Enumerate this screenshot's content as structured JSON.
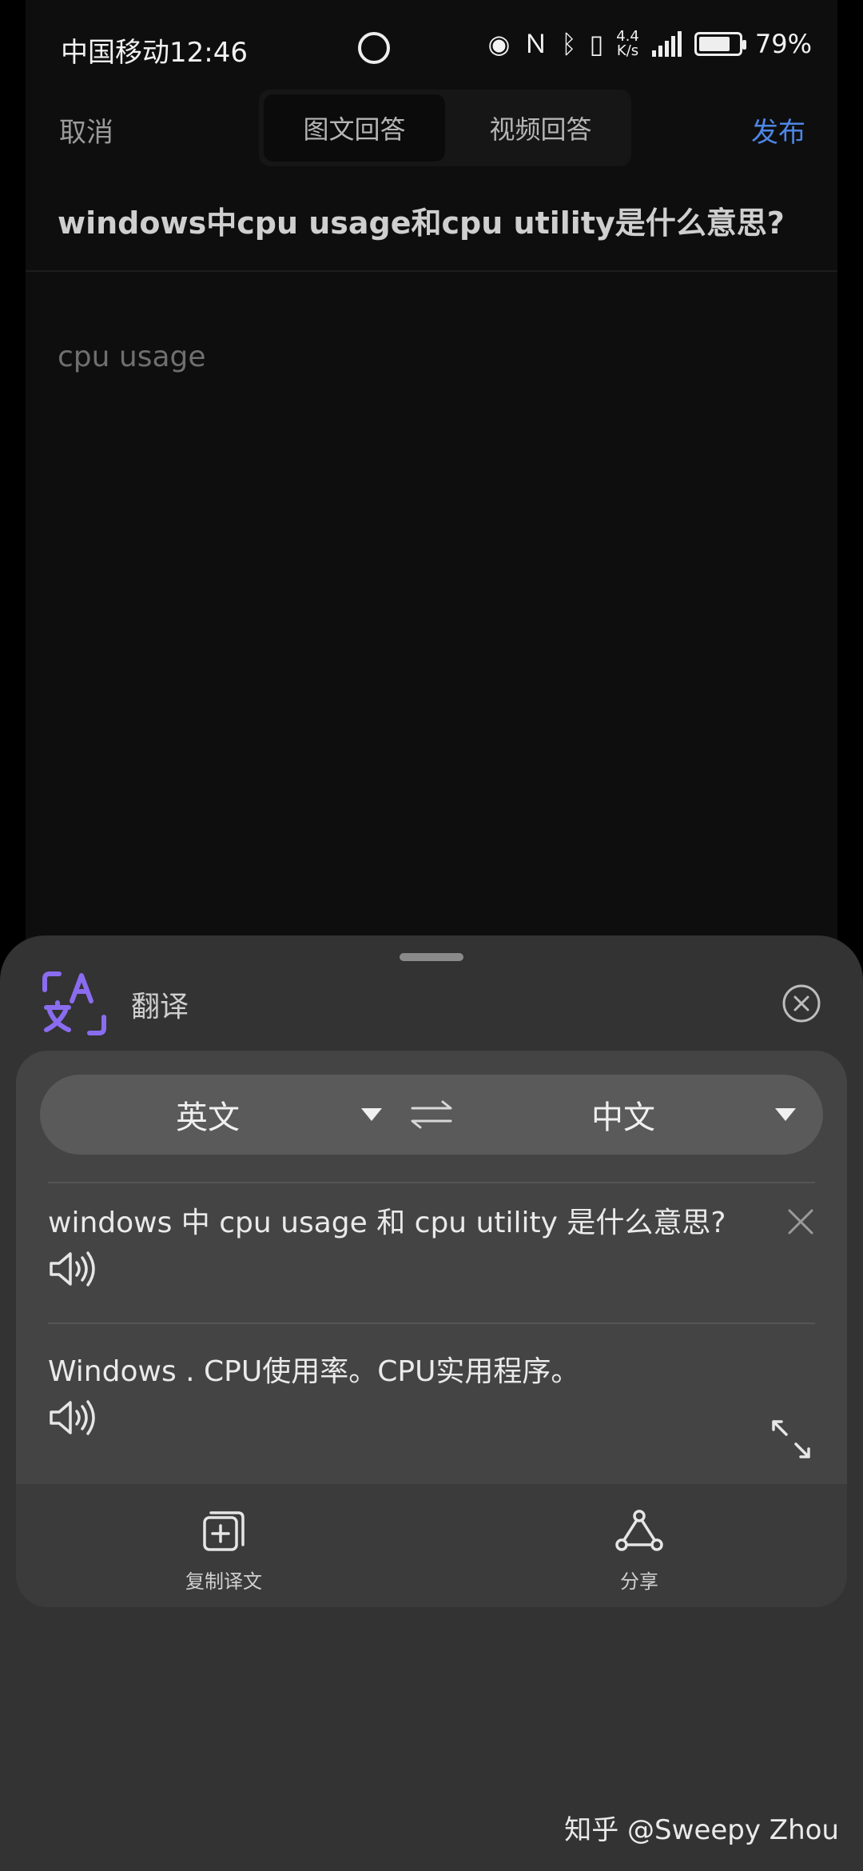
{
  "status_bar": {
    "carrier_time": "中国移动12:46",
    "net_speed_value": "4.4",
    "net_speed_unit": "K/s",
    "battery": "79%",
    "battery_level": 0.79
  },
  "header": {
    "cancel": "取消",
    "tabs": [
      {
        "label": "图文回答",
        "active": true
      },
      {
        "label": "视频回答",
        "active": false
      }
    ],
    "publish": "发布"
  },
  "question": {
    "title": "windows中cpu usage和cpu utility是什么意思?"
  },
  "answer": {
    "body": "cpu usage"
  },
  "translate_sheet": {
    "title": "翻译",
    "source_lang": "英文",
    "target_lang": "中文",
    "source_text": "windows 中 cpu usage 和 cpu utility 是什么意思?",
    "translated_text": "Windows . CPU使用率。CPU实用程序。",
    "actions": [
      {
        "label": "复制译文",
        "icon": "copy-icon"
      },
      {
        "label": "分享",
        "icon": "share-icon"
      }
    ],
    "accent_color": "#8a6cf0"
  },
  "watermark": "知乎 @Sweepy Zhou"
}
